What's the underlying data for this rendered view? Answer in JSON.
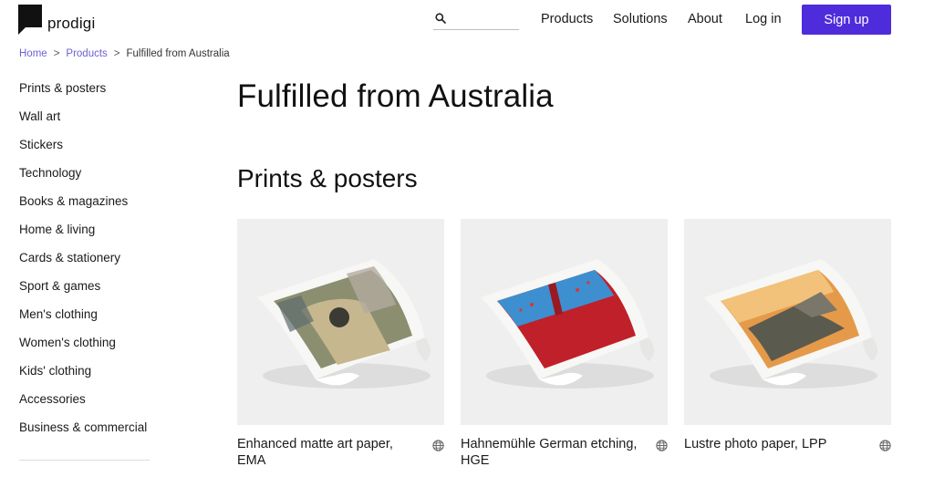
{
  "brand": {
    "name": "prodigi"
  },
  "header": {
    "search": {
      "placeholder": "",
      "value": ""
    },
    "nav": [
      {
        "label": "Products"
      },
      {
        "label": "Solutions"
      },
      {
        "label": "About"
      },
      {
        "label": "Log in"
      }
    ],
    "signup_label": "Sign up"
  },
  "breadcrumb": [
    {
      "label": "Home"
    },
    {
      "label": "Products"
    },
    {
      "label": "Fulfilled from Australia"
    }
  ],
  "breadcrumb_separator": ">",
  "sidebar": {
    "items": [
      {
        "label": "Prints & posters"
      },
      {
        "label": "Wall art"
      },
      {
        "label": "Stickers"
      },
      {
        "label": "Technology"
      },
      {
        "label": "Books & magazines"
      },
      {
        "label": "Home & living"
      },
      {
        "label": "Cards & stationery"
      },
      {
        "label": "Sport & games"
      },
      {
        "label": "Men's clothing"
      },
      {
        "label": "Women's clothing"
      },
      {
        "label": "Kids' clothing"
      },
      {
        "label": "Accessories"
      },
      {
        "label": "Business & commercial"
      }
    ]
  },
  "main": {
    "title": "Fulfilled from Australia",
    "section_title": "Prints & posters",
    "products": [
      {
        "name": "Enhanced matte art paper, EMA",
        "icon": "globe-icon"
      },
      {
        "name": "Hahnemühle German etching, HGE",
        "icon": "globe-icon"
      },
      {
        "name": "Lustre photo paper, LPP",
        "icon": "globe-icon"
      }
    ]
  },
  "colors": {
    "accent": "#4f2cdb",
    "link": "#6b5fd6",
    "card_bg": "#efefef"
  }
}
